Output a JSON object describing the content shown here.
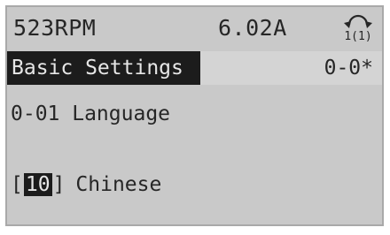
{
  "status": {
    "speed": "523RPM",
    "current": "6.02A",
    "setup_indicator": "1(1)"
  },
  "menu": {
    "title": "Basic Settings",
    "code": "0-0*"
  },
  "parameter": {
    "label": "0-01 Language"
  },
  "value": {
    "bracket_open": "[",
    "index": "10",
    "bracket_close": "]",
    "name": "Chinese"
  },
  "icons": {
    "setup": "setup-cycle-icon"
  }
}
